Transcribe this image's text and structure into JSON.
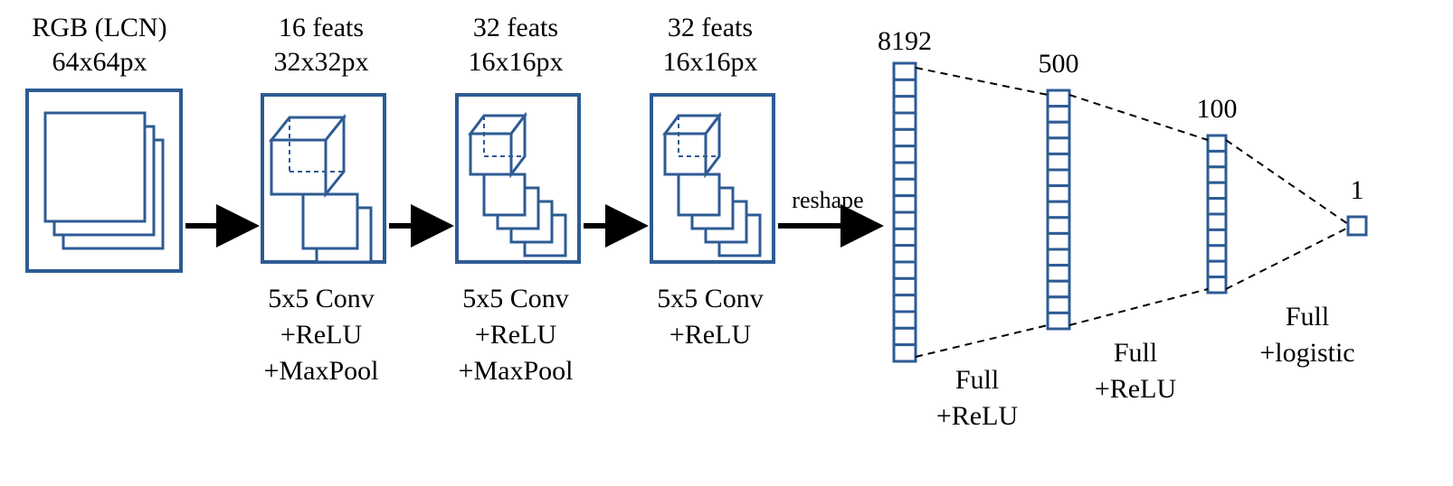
{
  "stroke": "#2E5B94",
  "blocks": {
    "input": {
      "top1": "RGB (LCN)",
      "top2": "64x64px"
    },
    "conv1": {
      "top1": "16 feats",
      "top2": "32x32px",
      "bot1": "5x5 Conv",
      "bot2": "+ReLU",
      "bot3": "+MaxPool"
    },
    "conv2": {
      "top1": "32 feats",
      "top2": "16x16px",
      "bot1": "5x5 Conv",
      "bot2": "+ReLU",
      "bot3": "+MaxPool"
    },
    "conv3": {
      "top1": "32 feats",
      "top2": "16x16px",
      "bot1": "5x5 Conv",
      "bot2": "+ReLU"
    },
    "reshape_label": "reshape",
    "fc1": {
      "count": "8192",
      "bot1": "Full",
      "bot2": "+ReLU"
    },
    "fc2": {
      "count": "500",
      "bot1": "Full",
      "bot2": "+ReLU"
    },
    "fc3": {
      "count": "100",
      "bot1": "Full",
      "bot2": "+logistic"
    },
    "out": {
      "count": "1"
    }
  }
}
